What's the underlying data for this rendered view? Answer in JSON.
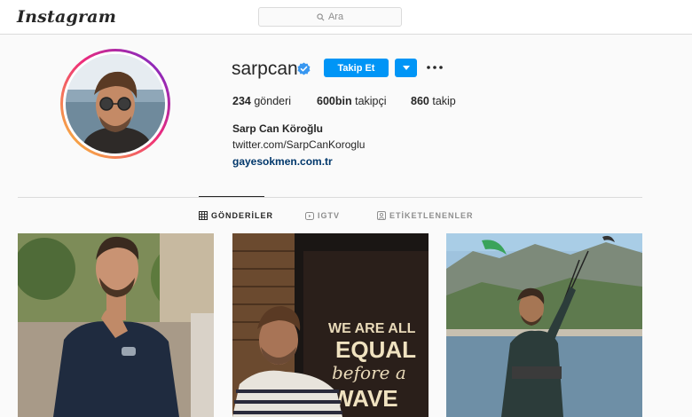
{
  "header": {
    "logo": "Instagram",
    "search_placeholder": "Ara"
  },
  "profile": {
    "username": "sarpcan",
    "verified": true,
    "follow_label": "Takip Et",
    "dropdown_icon": "chevron-down-icon",
    "more_icon": "more-options-icon",
    "stats": {
      "posts_count": "234",
      "posts_label": "gönderi",
      "followers_count": "600bin",
      "followers_label": "takipçi",
      "following_count": "860",
      "following_label": "takip"
    },
    "full_name": "Sarp Can Köroğlu",
    "bio": "twitter.com/SarpCanKoroglu",
    "website": "gayesokmen.com.tr"
  },
  "tabs": [
    {
      "label": "GÖNDERİLER",
      "icon": "grid-icon",
      "active": true
    },
    {
      "label": "IGTV",
      "icon": "igtv-icon",
      "active": false
    },
    {
      "label": "ETİKETLENENLER",
      "icon": "tagged-icon",
      "active": false
    }
  ],
  "posts": [
    {
      "image": "man-in-navy-tshirt-photo"
    },
    {
      "image": "man-with-we-are-all-equal-sign-photo",
      "sign_text": [
        "WE ARE ALL",
        "EQUAL",
        "before a",
        "WAVE"
      ]
    },
    {
      "image": "man-kitesurfing-photo"
    }
  ],
  "colors": {
    "accent": "#0095f6",
    "link": "#00376b",
    "verified": "#3897f0"
  }
}
